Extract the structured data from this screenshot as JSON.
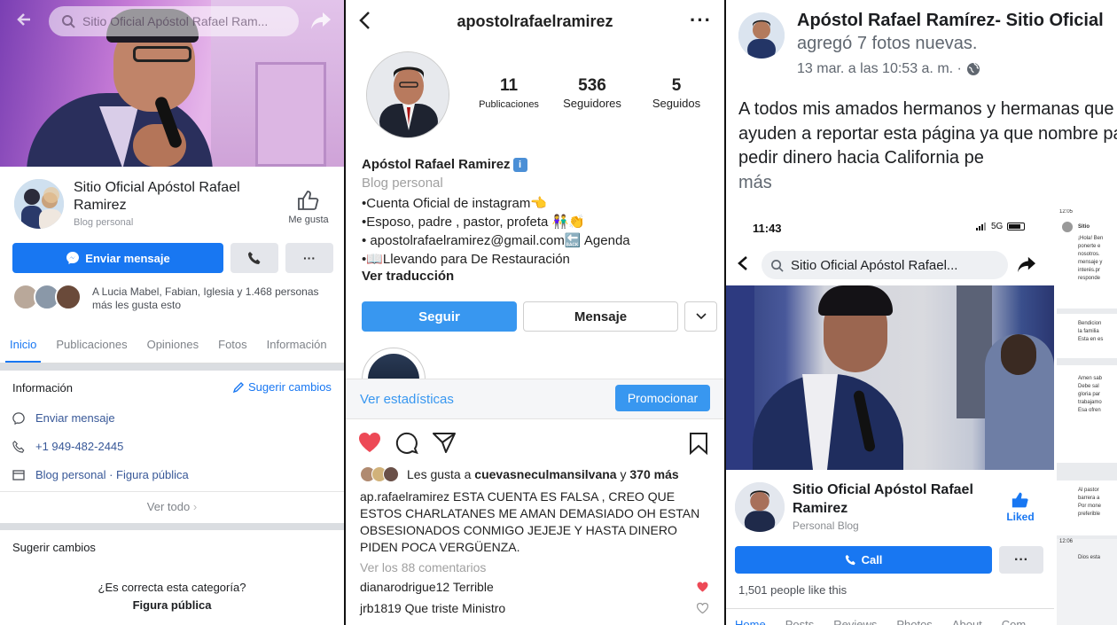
{
  "panel1": {
    "search_text": "Sitio Oficial Apóstol Rafael Ram...",
    "page_title": "Sitio Oficial Apóstol Rafael Ramirez",
    "category": "Blog personal",
    "like_label": "Me gusta",
    "message_button": "Enviar mensaje",
    "more_label": "···",
    "likers_text": "A Lucia Mabel, Fabian, Iglesia y 1.468 personas más les gusta esto",
    "tabs": [
      "Inicio",
      "Publicaciones",
      "Opiniones",
      "Fotos",
      "Información"
    ],
    "info_heading": "Información",
    "suggest_changes": "Sugerir cambios",
    "info_rows": {
      "message": "Enviar mensaje",
      "phone": "+1 949-482-2445",
      "category": "Blog personal · Figura pública"
    },
    "see_all": "Ver todo",
    "suggest_heading": "Sugerir cambios",
    "question": "¿Es correcta esta categoría?",
    "answer": "Figura pública",
    "colors": {
      "accent": "#1877f2"
    }
  },
  "panel2": {
    "username": "apostolrafaelramirez",
    "more": "···",
    "stats": [
      {
        "value": "11",
        "label": "Publicaciones"
      },
      {
        "value": "536",
        "label": "Seguidores"
      },
      {
        "value": "5",
        "label": "Seguidos"
      }
    ],
    "display_name": "Apóstol Rafael  Ramirez",
    "info_badge": "i",
    "category": "Blog personal",
    "bio": [
      "•Cuenta Oficial de instagram👈",
      "•Esposo, padre , pastor, profeta 👫👏",
      "• apostolrafaelramirez@gmail.com🔙 Agenda",
      "•📖Llevando para De Restauración"
    ],
    "translate": "Ver traducción",
    "follow_button": "Seguir",
    "message_button": "Mensaje",
    "stats_link": "Ver estadísticas",
    "promote_button": "Promocionar",
    "likes_prefix": "Les gusta a ",
    "likes_user": "cuevasneculmansilvana",
    "likes_mid": " y ",
    "likes_count": "370 más",
    "caption_user": "ap.rafaelramirez",
    "caption_text": " ESTA CUENTA ES FALSA , CREO QUE ESTOS CHARLATANES ME AMAN DEMASIADO OH ESTAN OBSESIONADOS CONMIGO JEJEJE Y HASTA DINERO PIDEN POCA VERGÜENZA.",
    "view_comments": "Ver los 88 comentarios",
    "comments": [
      {
        "user": "dianarodrigue12",
        "text": " Terrible"
      },
      {
        "user": "jrb1819",
        "text": " Que triste Ministro"
      }
    ],
    "colors": {
      "accent": "#3897f0",
      "heart": "#ed4956"
    }
  },
  "panel3": {
    "page_name": "Apóstol Rafael Ramírez- Sitio Oficial",
    "action": "agregó 7 fotos nuevas.",
    "timestamp": "13 mar. a las 10:53 a. m. ·",
    "post_text": "A todos mis amados hermanos y hermanas que me ayuden a reportar esta página ya que nombre para pedir dinero hacia California pe",
    "see_more": "más",
    "screenshot": {
      "time": "11:43",
      "network": "5G",
      "search_text": "Sitio Oficial Apóstol Rafael...",
      "page_title": "Sitio Oficial Apóstol Rafael Ramirez",
      "category": "Personal Blog",
      "liked_label": "Liked",
      "call_button": "Call",
      "more_label": "···",
      "people_like": "1,501 people like this",
      "tabs": [
        "Home",
        "Posts",
        "Reviews",
        "Photos",
        "About",
        "Com"
      ]
    },
    "chat": {
      "time1": "12:05",
      "name": "Sitio",
      "lines_a": [
        "¡Hola! Ben",
        "ponerte e",
        "nosotros.",
        "mensaje y",
        "interés.pr",
        "responde"
      ],
      "lines_b": [
        "Bendicion",
        "la familia",
        "Esta en es"
      ],
      "lines_c": [
        "Amen sab",
        "Debe sal",
        "gloria par",
        "trabajamo",
        "Esa ofren"
      ],
      "lines_d": [
        "Al pastor",
        "barrera a",
        "Por mone",
        "preferible"
      ],
      "time2": "12:06",
      "lines_e": [
        "Dios esta"
      ]
    }
  }
}
